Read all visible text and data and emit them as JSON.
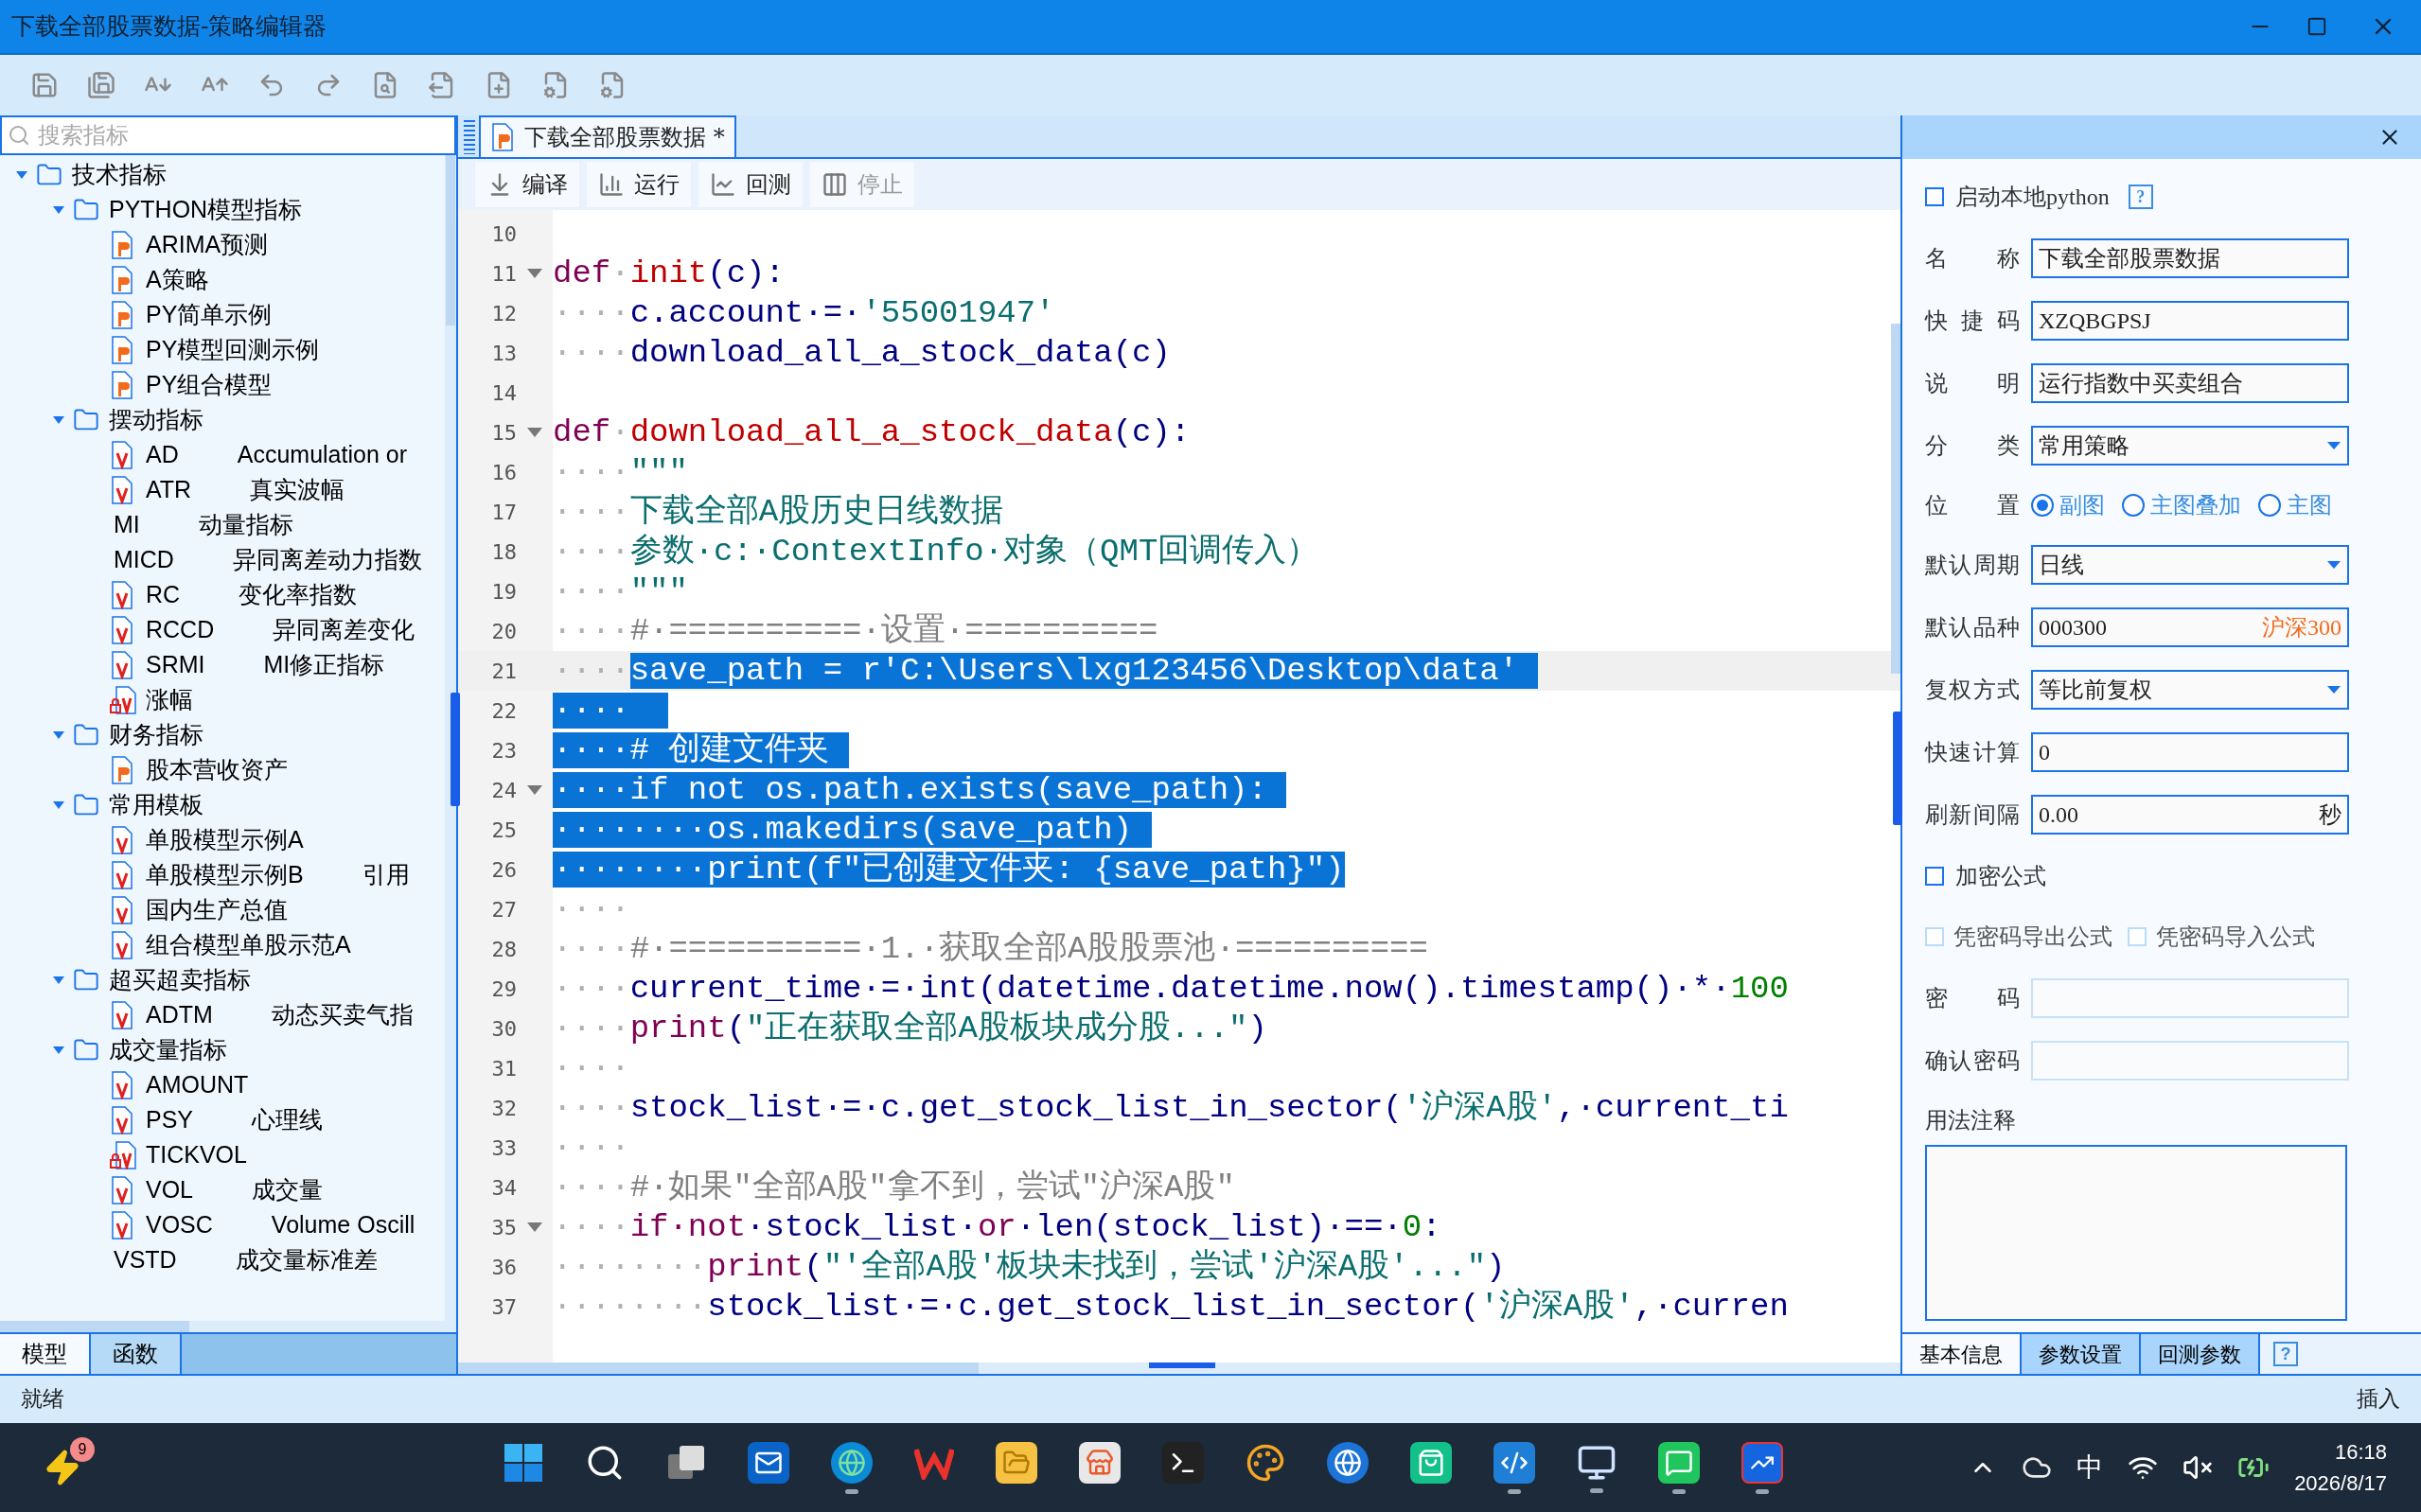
{
  "window": {
    "title": "下载全部股票数据-策略编辑器"
  },
  "left_panel": {
    "search": {
      "placeholder": "搜索指标"
    },
    "tree": [
      {
        "label": "技术指标",
        "kind": "folder",
        "expanded": true,
        "children": [
          {
            "label": "PYTHON模型指标",
            "kind": "folder",
            "expanded": true,
            "children": [
              {
                "label": "ARIMA预测",
                "kind": "py"
              },
              {
                "label": "A策略",
                "kind": "py"
              },
              {
                "label": "PY简单示例",
                "kind": "py"
              },
              {
                "label": "PY模型回测示例",
                "kind": "py"
              },
              {
                "label": "PY组合模型",
                "kind": "py"
              }
            ]
          },
          {
            "label": "摆动指标",
            "kind": "folder",
            "expanded": true,
            "children": [
              {
                "label": "AD",
                "desc": "Accumulation or",
                "kind": "v"
              },
              {
                "label": "ATR",
                "desc": "真实波幅",
                "kind": "v"
              },
              {
                "label": "MI",
                "desc": "动量指标",
                "kind": "plain"
              },
              {
                "label": "MICD",
                "desc": "异同离差动力指数",
                "kind": "plain"
              },
              {
                "label": "RC",
                "desc": "变化率指数",
                "kind": "v"
              },
              {
                "label": "RCCD",
                "desc": "异同离差变化",
                "kind": "v"
              },
              {
                "label": "SRMI",
                "desc": "MI修正指标",
                "kind": "v"
              },
              {
                "label": "涨幅",
                "kind": "lockv"
              }
            ]
          },
          {
            "label": "财务指标",
            "kind": "folder",
            "expanded": true,
            "children": [
              {
                "label": "股本营收资产",
                "kind": "py"
              }
            ]
          },
          {
            "label": "常用模板",
            "kind": "folder",
            "expanded": true,
            "children": [
              {
                "label": "单股模型示例A",
                "kind": "v"
              },
              {
                "label": "单股模型示例B",
                "desc": "引用",
                "kind": "v"
              },
              {
                "label": "国内生产总值",
                "kind": "v"
              },
              {
                "label": "组合模型单股示范A",
                "kind": "v"
              }
            ]
          },
          {
            "label": "超买超卖指标",
            "kind": "folder",
            "expanded": true,
            "children": [
              {
                "label": "ADTM",
                "desc": "动态买卖气指",
                "kind": "v"
              }
            ]
          },
          {
            "label": "成交量指标",
            "kind": "folder",
            "expanded": true,
            "children": [
              {
                "label": "AMOUNT",
                "kind": "v"
              },
              {
                "label": "PSY",
                "desc": "心理线",
                "kind": "v"
              },
              {
                "label": "TICKVOL",
                "kind": "lockv"
              },
              {
                "label": "VOL",
                "desc": "成交量",
                "kind": "v"
              },
              {
                "label": "VOSC",
                "desc": "Volume Oscill",
                "kind": "v"
              },
              {
                "label": "VSTD",
                "desc": "成交量标准差",
                "kind": "plain"
              }
            ]
          }
        ]
      }
    ],
    "tabs": [
      {
        "label": "模型",
        "selected": true
      },
      {
        "label": "函数",
        "selected": false
      }
    ]
  },
  "editor": {
    "tab": {
      "label": "下载全部股票数据 *"
    },
    "actions": [
      {
        "label": "编译",
        "kind": "compile",
        "disabled": false
      },
      {
        "label": "运行",
        "kind": "run",
        "disabled": false
      },
      {
        "label": "回测",
        "kind": "backtest",
        "disabled": false
      },
      {
        "label": "停止",
        "kind": "stop",
        "disabled": true
      }
    ],
    "lines": [
      {
        "num": "10",
        "fold": false,
        "current": false
      },
      {
        "num": "11",
        "fold": true,
        "current": false,
        "tokens": [
          {
            "kind": "kw",
            "text": "def"
          },
          {
            "kind": "ws",
            "text": "·"
          },
          {
            "kind": "fn",
            "text": "init"
          },
          {
            "kind": "id",
            "text": "(c):"
          }
        ]
      },
      {
        "num": "12",
        "fold": false,
        "current": false,
        "tokens": [
          {
            "kind": "ws",
            "text": "····"
          },
          {
            "kind": "id",
            "text": "c.account·=·"
          },
          {
            "kind": "str",
            "text": "'55001947'"
          }
        ]
      },
      {
        "num": "13",
        "fold": false,
        "current": false,
        "tokens": [
          {
            "kind": "ws",
            "text": "····"
          },
          {
            "kind": "id",
            "text": "download_all_a_stock_data(c)"
          }
        ]
      },
      {
        "num": "14",
        "fold": false,
        "current": false
      },
      {
        "num": "15",
        "fold": true,
        "current": false,
        "tokens": [
          {
            "kind": "kw",
            "text": "def"
          },
          {
            "kind": "ws",
            "text": "·"
          },
          {
            "kind": "fn",
            "text": "download_all_a_stock_data"
          },
          {
            "kind": "id",
            "text": "(c):"
          }
        ]
      },
      {
        "num": "16",
        "fold": false,
        "current": false,
        "tokens": [
          {
            "kind": "ws",
            "text": "····"
          },
          {
            "kind": "str",
            "text": "\"\"\""
          }
        ]
      },
      {
        "num": "17",
        "fold": false,
        "current": false,
        "tokens": [
          {
            "kind": "ws",
            "text": "····"
          },
          {
            "kind": "str",
            "text": "下载全部A股历史日线数据"
          }
        ]
      },
      {
        "num": "18",
        "fold": false,
        "current": false,
        "tokens": [
          {
            "kind": "ws",
            "text": "····"
          },
          {
            "kind": "str",
            "text": "参数·c:·ContextInfo·对象（QMT回调传入）"
          }
        ]
      },
      {
        "num": "19",
        "fold": false,
        "current": false,
        "tokens": [
          {
            "kind": "ws",
            "text": "····"
          },
          {
            "kind": "str",
            "text": "\"\"\""
          }
        ]
      },
      {
        "num": "20",
        "fold": false,
        "current": false,
        "tokens": [
          {
            "kind": "ws",
            "text": "····"
          },
          {
            "kind": "cm",
            "text": "#·==========·设置·=========="
          }
        ]
      },
      {
        "num": "21",
        "fold": false,
        "current": true,
        "tokens": [
          {
            "kind": "ws",
            "text": "····"
          }
        ],
        "selection": "save_path = r'C:\\Users\\lxg123456\\Desktop\\data' "
      },
      {
        "num": "22",
        "fold": false,
        "current": false,
        "selection": "····  "
      },
      {
        "num": "23",
        "fold": false,
        "current": false,
        "selection": "····# 创建文件夹 "
      },
      {
        "num": "24",
        "fold": true,
        "current": false,
        "selection": "····if not os.path.exists(save_path): "
      },
      {
        "num": "25",
        "fold": false,
        "current": false,
        "selection": "········os.makedirs(save_path) "
      },
      {
        "num": "26",
        "fold": false,
        "current": false,
        "selection": "········print(f\"已创建文件夹: {save_path}\")"
      },
      {
        "num": "27",
        "fold": false,
        "current": false,
        "tokens": [
          {
            "kind": "ws",
            "text": "····"
          }
        ]
      },
      {
        "num": "28",
        "fold": false,
        "current": false,
        "tokens": [
          {
            "kind": "ws",
            "text": "····"
          },
          {
            "kind": "cm",
            "text": "#·==========·1.·获取全部A股股票池·=========="
          }
        ]
      },
      {
        "num": "29",
        "fold": false,
        "current": false,
        "tokens": [
          {
            "kind": "ws",
            "text": "····"
          },
          {
            "kind": "id",
            "text": "current_time·=·int(datetime.datetime.now().timestamp()·*·"
          },
          {
            "kind": "num",
            "text": "100"
          }
        ]
      },
      {
        "num": "30",
        "fold": false,
        "current": false,
        "tokens": [
          {
            "kind": "ws",
            "text": "····"
          },
          {
            "kind": "kw",
            "text": "print"
          },
          {
            "kind": "id",
            "text": "("
          },
          {
            "kind": "str",
            "text": "\"正在获取全部A股板块成分股...\""
          },
          {
            "kind": "id",
            "text": ")"
          }
        ]
      },
      {
        "num": "31",
        "fold": false,
        "current": false,
        "tokens": [
          {
            "kind": "ws",
            "text": "····"
          }
        ]
      },
      {
        "num": "32",
        "fold": false,
        "current": false,
        "tokens": [
          {
            "kind": "ws",
            "text": "····"
          },
          {
            "kind": "id",
            "text": "stock_list·=·c.get_stock_list_in_sector("
          },
          {
            "kind": "str",
            "text": "'沪深A股'"
          },
          {
            "kind": "id",
            "text": ",·current_ti"
          }
        ]
      },
      {
        "num": "33",
        "fold": false,
        "current": false,
        "tokens": [
          {
            "kind": "ws",
            "text": "····"
          }
        ]
      },
      {
        "num": "34",
        "fold": false,
        "current": false,
        "tokens": [
          {
            "kind": "ws",
            "text": "····"
          },
          {
            "kind": "cm",
            "text": "#·如果\"全部A股\"拿不到，尝试\"沪深A股\""
          }
        ]
      },
      {
        "num": "35",
        "fold": true,
        "current": false,
        "tokens": [
          {
            "kind": "ws",
            "text": "····"
          },
          {
            "kind": "kw",
            "text": "if·not"
          },
          {
            "kind": "id",
            "text": "·stock_list·"
          },
          {
            "kind": "kw",
            "text": "or"
          },
          {
            "kind": "id",
            "text": "·len(stock_list)·==·"
          },
          {
            "kind": "num",
            "text": "0"
          },
          {
            "kind": "id",
            "text": ":"
          }
        ]
      },
      {
        "num": "36",
        "fold": false,
        "current": false,
        "tokens": [
          {
            "kind": "ws",
            "text": "········"
          },
          {
            "kind": "kw",
            "text": "print"
          },
          {
            "kind": "id",
            "text": "("
          },
          {
            "kind": "str",
            "text": "\"'全部A股'板块未找到，尝试'沪深A股'...\""
          },
          {
            "kind": "id",
            "text": ")"
          }
        ]
      },
      {
        "num": "37",
        "fold": false,
        "current": false,
        "tokens": [
          {
            "kind": "ws",
            "text": "········"
          },
          {
            "kind": "id",
            "text": "stock_list·=·c.get_stock_list_in_sector("
          },
          {
            "kind": "str",
            "text": "'沪深A股'"
          },
          {
            "kind": "id",
            "text": ",·curren"
          }
        ]
      }
    ]
  },
  "properties": {
    "form": [
      {
        "kind": "checkbox",
        "label": "启动本地python",
        "checked": false,
        "disabled": false,
        "help": "?"
      },
      {
        "kind": "input",
        "label": "名称",
        "value": "下载全部股票数据",
        "disabled": false
      },
      {
        "kind": "input",
        "label": "快捷码",
        "value": "XZQBGPSJ",
        "disabled": false
      },
      {
        "kind": "input",
        "label": "说明",
        "value": "运行指数中买卖组合",
        "disabled": false
      },
      {
        "kind": "select",
        "label": "分类",
        "value": "常用策略"
      },
      {
        "kind": "radio",
        "label": "位置",
        "options": [
          {
            "label": "副图",
            "selected": true
          },
          {
            "label": "主图叠加",
            "selected": false
          },
          {
            "label": "主图",
            "selected": false
          }
        ]
      },
      {
        "kind": "select",
        "label": "默认周期",
        "value": "日线"
      },
      {
        "kind": "input",
        "label": "默认品种",
        "value": "000300",
        "suffix": "沪深300",
        "suffix_highlight": true,
        "disabled": false
      },
      {
        "kind": "select",
        "label": "复权方式",
        "value": "等比前复权"
      },
      {
        "kind": "input",
        "label": "快速计算",
        "value": "0",
        "disabled": false
      },
      {
        "kind": "input",
        "label": "刷新间隔",
        "value": "0.00",
        "suffix": "秒",
        "suffix_highlight": false,
        "disabled": false
      },
      {
        "kind": "checkbox",
        "label": "加密公式",
        "checked": false,
        "disabled": false
      },
      {
        "kind": "checkbox_pair",
        "items": [
          {
            "label": "凭密码导出公式",
            "checked": false,
            "disabled": true
          },
          {
            "label": "凭密码导入公式",
            "checked": false,
            "disabled": true
          }
        ]
      },
      {
        "kind": "input",
        "label": "密码",
        "disabled": true
      },
      {
        "kind": "input",
        "label": "确认密码",
        "disabled": true
      },
      {
        "kind": "textarea",
        "label": "用法注释"
      }
    ],
    "tabs": [
      {
        "label": "基本信息",
        "selected": true
      },
      {
        "label": "参数设置",
        "selected": false
      },
      {
        "label": "回测参数",
        "selected": false
      }
    ],
    "help": "?"
  },
  "status_bar": {
    "left": "就绪",
    "right": "插入"
  },
  "taskbar": {
    "weather_badge": "9",
    "apps": [
      {
        "kind": "start",
        "running": false
      },
      {
        "kind": "search",
        "running": false
      },
      {
        "kind": "taskview",
        "running": false
      },
      {
        "kind": "mail",
        "running": false
      },
      {
        "kind": "browser",
        "running": true
      },
      {
        "kind": "office",
        "running": false
      },
      {
        "kind": "files",
        "running": false
      },
      {
        "kind": "store",
        "running": false
      },
      {
        "kind": "terminal",
        "running": false
      },
      {
        "kind": "paint",
        "running": false
      },
      {
        "kind": "browser2",
        "running": false
      },
      {
        "kind": "bag",
        "running": false
      },
      {
        "kind": "code",
        "running": true
      },
      {
        "kind": "remote",
        "running": true
      },
      {
        "kind": "chat",
        "running": true
      },
      {
        "kind": "trading",
        "running": true
      }
    ],
    "ime": "中",
    "time": "16:18",
    "date": "2026/8/17"
  }
}
